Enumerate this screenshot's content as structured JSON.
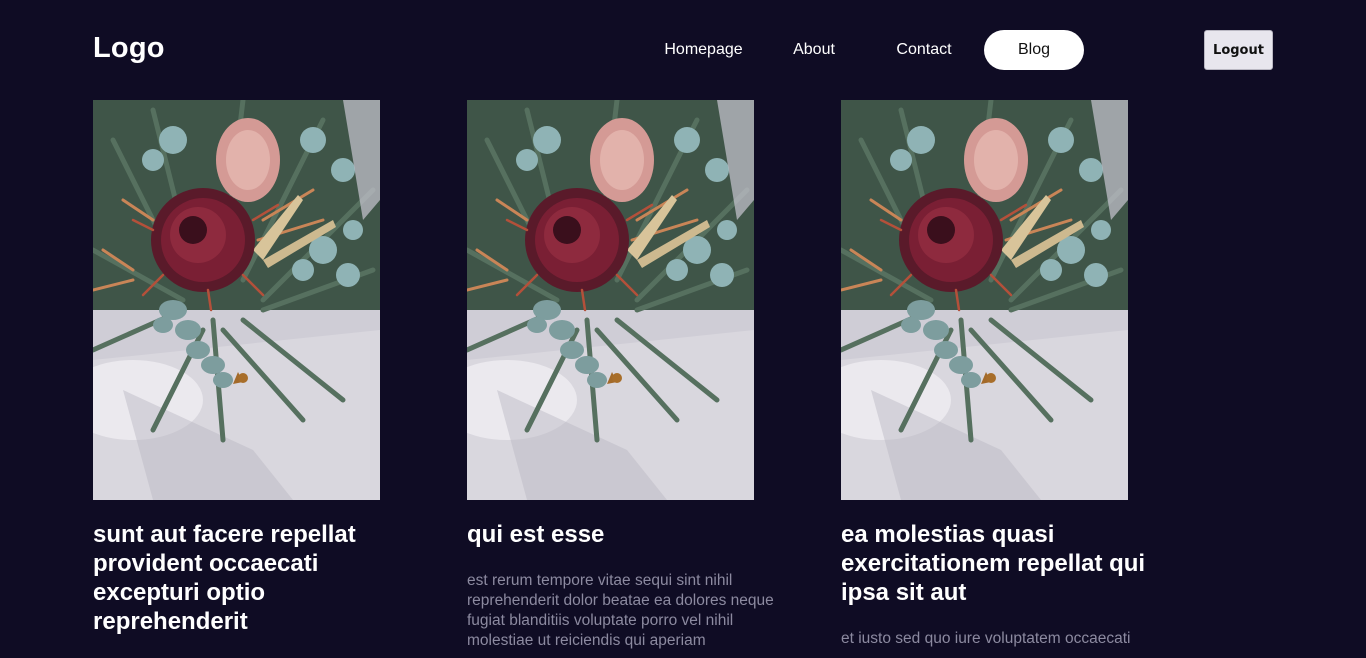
{
  "header": {
    "logo": "Logo",
    "nav": [
      {
        "label": "Homepage"
      },
      {
        "label": "About"
      },
      {
        "label": "Contact"
      },
      {
        "label": "Blog",
        "active": true
      }
    ],
    "logout_label": "Logout"
  },
  "posts": [
    {
      "title": "sunt aut facere repellat provident occaecati excepturi optio reprehenderit",
      "excerpt": "",
      "image": "flower-bouquet-photo"
    },
    {
      "title": "qui est esse",
      "excerpt": "est rerum tempore vitae sequi sint nihil reprehenderit dolor beatae ea dolores neque fugiat blanditiis voluptate porro vel nihil molestiae ut reiciendis qui aperiam",
      "image": "flower-bouquet-photo"
    },
    {
      "title": "ea molestias quasi exercitationem repellat qui ipsa sit aut",
      "excerpt": "et iusto sed quo iure voluptatem occaecati",
      "image": "flower-bouquet-photo"
    }
  ],
  "colors": {
    "background": "#0f0c24",
    "excerpt_text": "#8c8aa0",
    "active_pill": "#ffffff",
    "logout_bg": "#e8e6ee"
  }
}
